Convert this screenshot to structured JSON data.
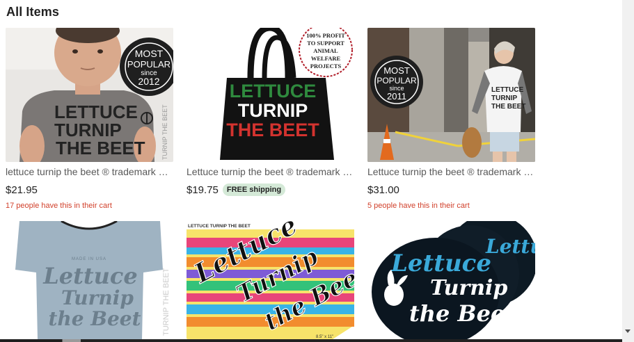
{
  "section": {
    "heading": "All Items"
  },
  "listings": [
    {
      "title": "lettuce turnip the beet ® trademark brand",
      "price": "$21.95",
      "free_shipping": "",
      "cart_note": "17 people have this in their cart",
      "image": {
        "badge_line1": "MOST",
        "badge_line2": "POPULAR",
        "badge_line3": "since",
        "badge_line4": "2012",
        "shirt_line1": "LETTUCE",
        "shirt_line2": "TURNIP",
        "shirt_line3": "THE BEET",
        "side_text": "TURNIP THE BEET"
      }
    },
    {
      "title": "Lettuce turnip the beet ® trademark brand",
      "price": "$19.75",
      "free_shipping": "FREE shipping",
      "cart_note": "",
      "image": {
        "stamp_line1": "100% PROFIT",
        "stamp_line2": "TO SUPPORT",
        "stamp_line3": "ANIMAL",
        "stamp_line4": "WELFARE",
        "stamp_line5": "PROJECTS",
        "bag_line1": "LETTUCE",
        "bag_line2": "TURNIP",
        "bag_line3": "THE BEET"
      }
    },
    {
      "title": "Lettuce turnip the beet ® trademark brand",
      "price": "$31.00",
      "free_shipping": "",
      "cart_note": "5 people have this in their cart",
      "image": {
        "badge_line1": "MOST",
        "badge_line2": "POPULAR",
        "badge_line3": "since",
        "badge_line4": "2011",
        "shirt_line1": "LETTUCE",
        "shirt_line2": "TURNIP",
        "shirt_line3": "THE BEET"
      }
    },
    {
      "title": "",
      "price": "",
      "free_shipping": "",
      "cart_note": "",
      "image": {
        "tag_line1": "MADE IN USA",
        "script_line1": "Lettuce",
        "script_line2": "Turnip",
        "script_line3": "the Beet",
        "side_text": "TURNIP THE BEET"
      }
    },
    {
      "title": "",
      "price": "",
      "free_shipping": "",
      "cart_note": "",
      "image": {
        "header_text": "LETTUCE TURNIP THE BEET",
        "script_line1": "Lettuce",
        "script_line2": "Turnip",
        "script_line3": "the Beet",
        "size_text": "8.5\" x 11\""
      }
    },
    {
      "title": "",
      "price": "",
      "free_shipping": "",
      "cart_note": "",
      "image": {
        "script_line1": "Lettuce",
        "script_line2": "Turnip",
        "script_line3": "the Beet"
      }
    }
  ],
  "colors": {
    "cart_note": "#d1402b",
    "free_shipping_bg": "#d4e9d7",
    "title_text": "#595959"
  }
}
